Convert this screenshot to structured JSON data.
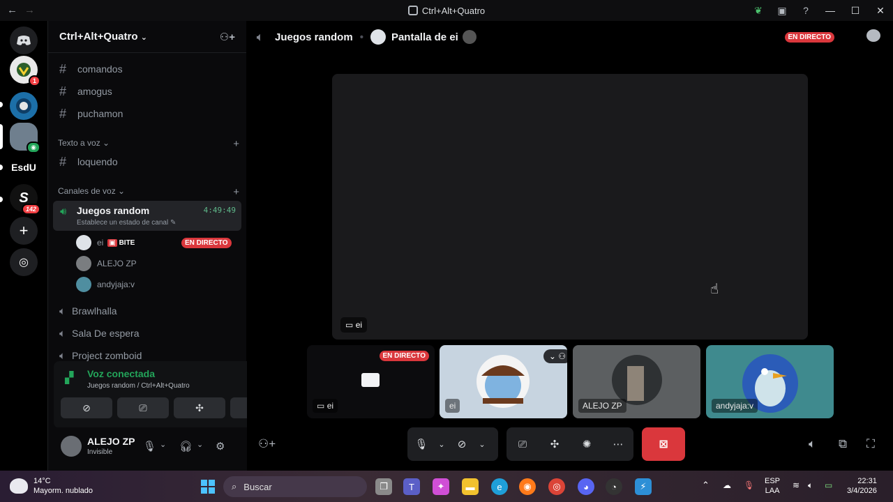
{
  "window": {
    "title": "Ctrl+Alt+Quatro",
    "back": "←",
    "forward": "→",
    "controls": {
      "minimize": "—",
      "maximize": "☐",
      "close": "✕"
    }
  },
  "servers": [
    {
      "id": "home",
      "label": "",
      "color": "#1e1f22"
    },
    {
      "id": "s1",
      "label": "",
      "badge": "1",
      "color": "#e9e9e9"
    },
    {
      "id": "s2",
      "label": "",
      "color": "#1c6fa8"
    },
    {
      "id": "s3",
      "label": "",
      "color": "#7a8a9a"
    },
    {
      "id": "s4",
      "label": "EsdU",
      "color": "#000000"
    },
    {
      "id": "s5",
      "label": "S",
      "badge": "142",
      "color": "#111111"
    }
  ],
  "guild": {
    "name": "Ctrl+Alt+Quatro",
    "channels_text": [
      "comandos",
      "amogus",
      "puchamon"
    ],
    "category_tts": "Texto a voz",
    "tts_channels": [
      "loquendo"
    ],
    "category_voice": "Canales de voz",
    "active_voice": {
      "name": "Juegos random",
      "time": "4:49:49",
      "status": "Establece un estado de canal"
    },
    "members": [
      {
        "name": "ei",
        "tag": "BITE",
        "live": "EN DIRECTO"
      },
      {
        "name": "ALEJO ZP"
      },
      {
        "name": "andyjaja:v"
      }
    ],
    "other_voice": [
      "Brawlhalla",
      "Sala De espera",
      "Project zomboid"
    ]
  },
  "voice_panel": {
    "title": "Voz conectada",
    "subtitle": "Juegos random / Ctrl+Alt+Quatro"
  },
  "user": {
    "name": "ALEJO ZP",
    "status": "Invisible"
  },
  "main": {
    "channel": "Juegos random",
    "stream": "Pantalla de ei",
    "live": "EN DIRECTO",
    "stage_label": "ei",
    "tiles": [
      {
        "label": "ei",
        "live": "EN DIRECTO",
        "kind": "screen"
      },
      {
        "label": "ei",
        "kind": "avatar"
      },
      {
        "label": "ALEJO ZP",
        "kind": "photo"
      },
      {
        "label": "andyjaja:v",
        "kind": "penguin"
      }
    ]
  },
  "taskbar": {
    "temp": "14°C",
    "weather": "Mayorm. nublado",
    "search_placeholder": "Buscar",
    "lang1": "ESP",
    "lang2": "LAA",
    "time": "22:31",
    "date": "3/4/2026"
  },
  "colors": {
    "accent_green": "#23a55a",
    "live_red": "#da373c",
    "sidebar_bg": "#0a0a0c"
  }
}
